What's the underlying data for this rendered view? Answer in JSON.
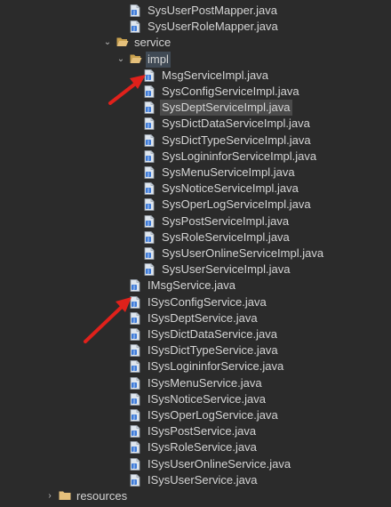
{
  "colors": {
    "background": "#2b2b2b",
    "text": "#d4d4d4",
    "folder": "#e5c07b",
    "file_page": "#dfe6ee",
    "file_badge": "#3d7bd9",
    "arrow": "#e0211b"
  },
  "tree": {
    "mapper_files": [
      {
        "label": "SysUserPostMapper.java",
        "icon": "java-file-icon"
      },
      {
        "label": "SysUserRoleMapper.java",
        "icon": "java-file-icon"
      }
    ],
    "service_folder": {
      "label": "service",
      "icon": "folder-open-icon",
      "chevron": "chevron-down-icon"
    },
    "impl_folder": {
      "label": "impl",
      "icon": "folder-open-icon",
      "chevron": "chevron-down-icon"
    },
    "impl_files": [
      {
        "label": "MsgServiceImpl.java"
      },
      {
        "label": "SysConfigServiceImpl.java"
      },
      {
        "label": "SysDeptServiceImpl.java",
        "selected": true
      },
      {
        "label": "SysDictDataServiceImpl.java"
      },
      {
        "label": "SysDictTypeServiceImpl.java"
      },
      {
        "label": "SysLogininforServiceImpl.java"
      },
      {
        "label": "SysMenuServiceImpl.java"
      },
      {
        "label": "SysNoticeServiceImpl.java"
      },
      {
        "label": "SysOperLogServiceImpl.java"
      },
      {
        "label": "SysPostServiceImpl.java"
      },
      {
        "label": "SysRoleServiceImpl.java"
      },
      {
        "label": "SysUserOnlineServiceImpl.java"
      },
      {
        "label": "SysUserServiceImpl.java"
      }
    ],
    "service_files": [
      {
        "label": "IMsgService.java"
      },
      {
        "label": "ISysConfigService.java"
      },
      {
        "label": "ISysDeptService.java"
      },
      {
        "label": "ISysDictDataService.java"
      },
      {
        "label": "ISysDictTypeService.java"
      },
      {
        "label": "ISysLogininforService.java"
      },
      {
        "label": "ISysMenuService.java"
      },
      {
        "label": "ISysNoticeService.java"
      },
      {
        "label": "ISysOperLogService.java"
      },
      {
        "label": "ISysPostService.java"
      },
      {
        "label": "ISysRoleService.java"
      },
      {
        "label": "ISysUserOnlineService.java"
      },
      {
        "label": "ISysUserService.java"
      }
    ],
    "resources_folder": {
      "label": "resources",
      "icon": "folder-closed-icon",
      "chevron": "chevron-right-icon"
    }
  },
  "annotations": [
    {
      "name": "red-arrow-to-msgserviceimpl",
      "color": "#e0211b"
    },
    {
      "name": "red-arrow-to-imsgservice",
      "color": "#e0211b"
    }
  ]
}
